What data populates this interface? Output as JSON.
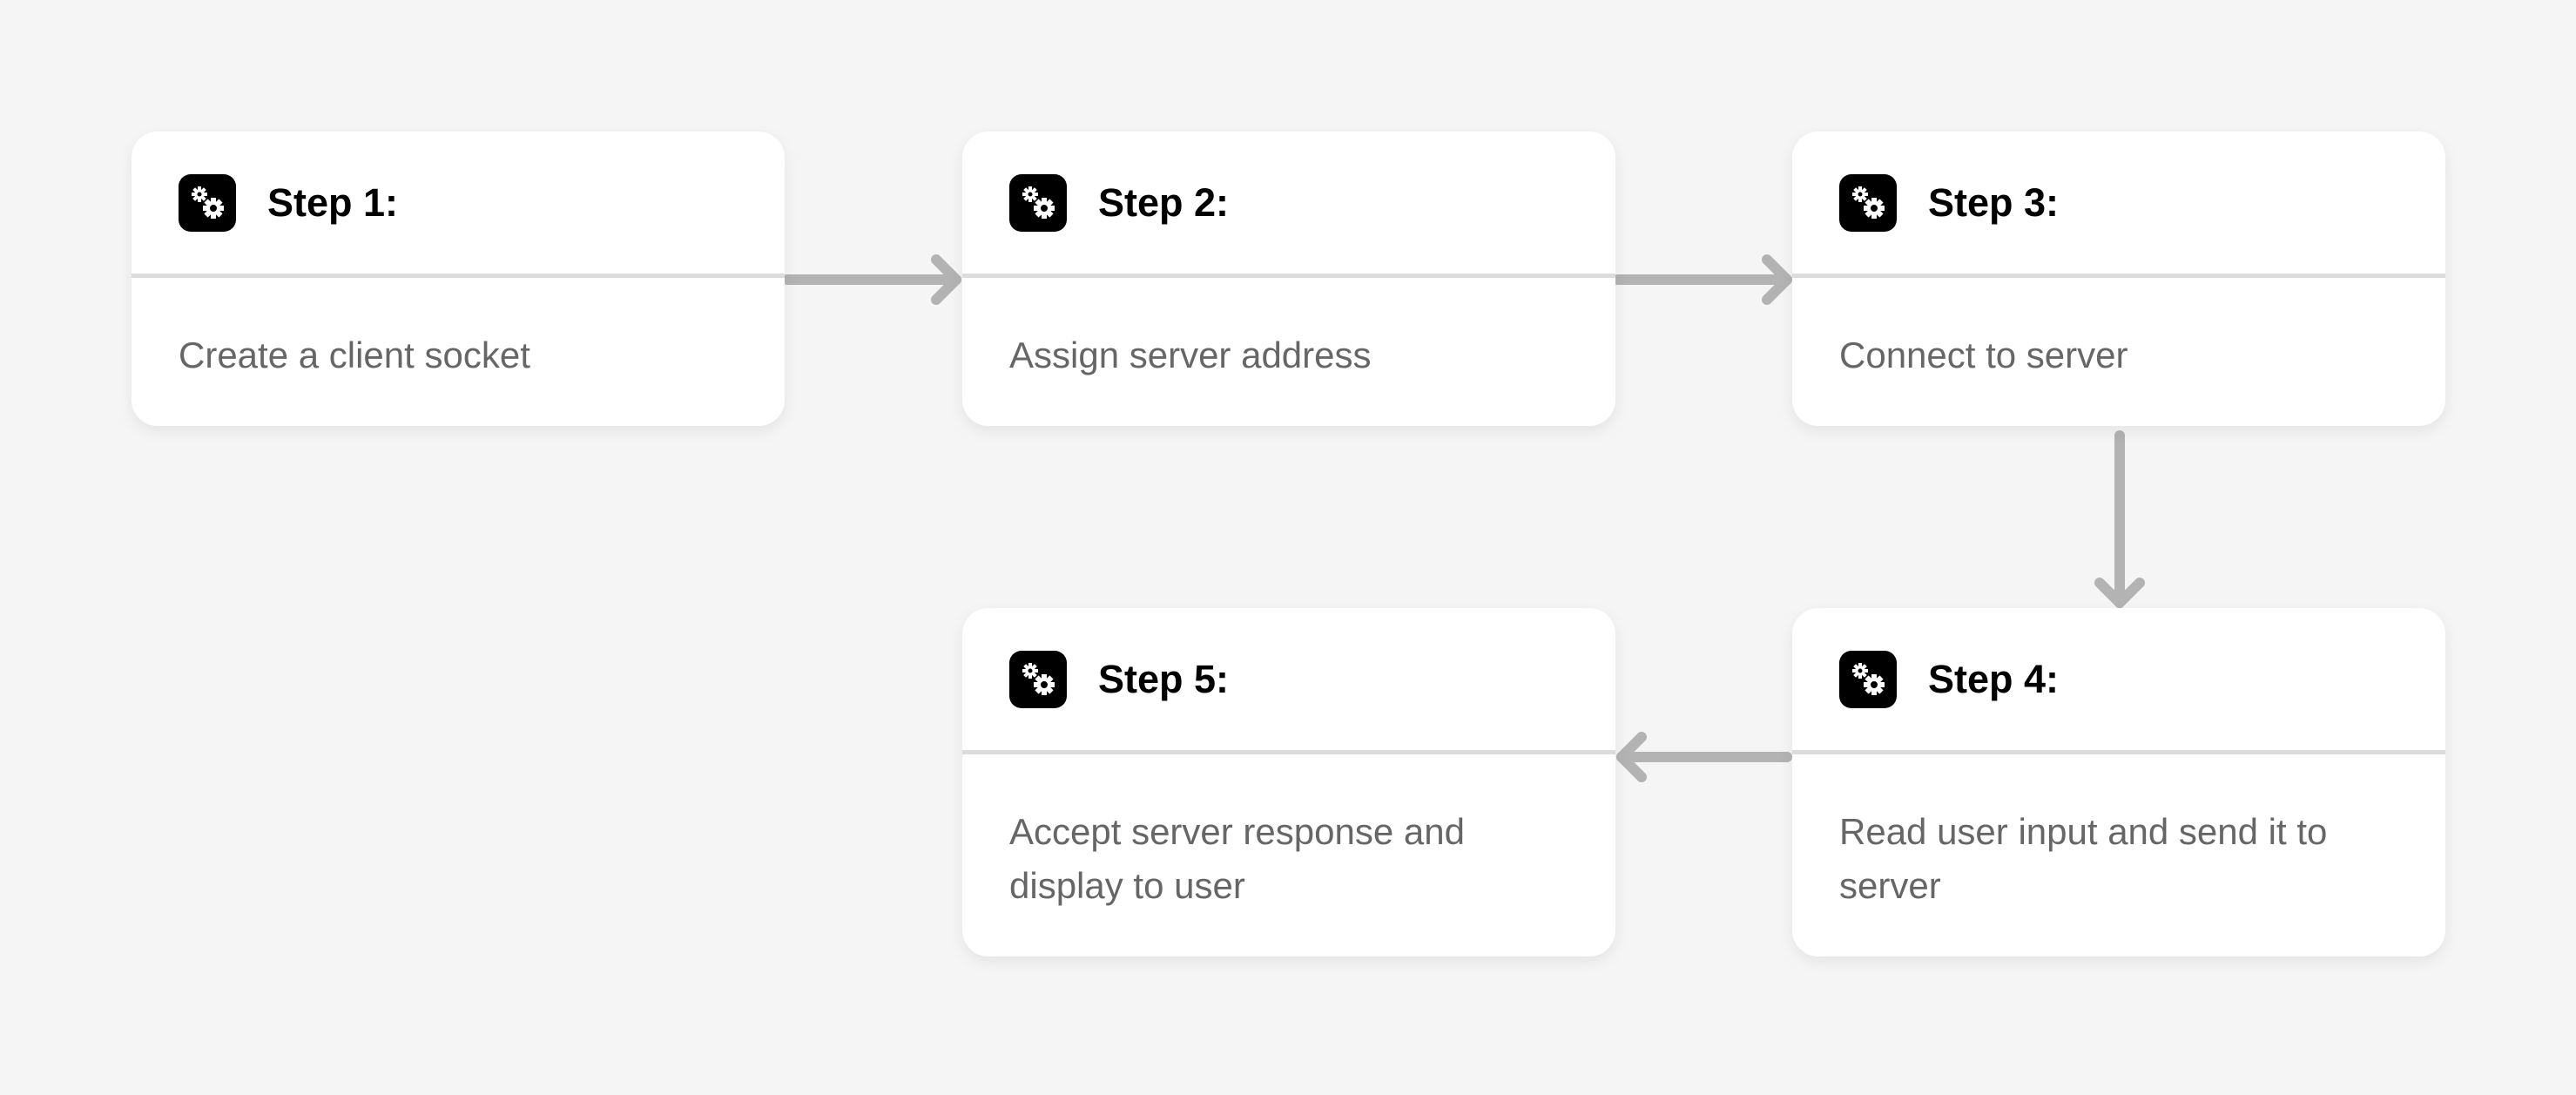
{
  "colors": {
    "background": "#f5f5f5",
    "card": "#ffffff",
    "arrow": "#b3b3b3",
    "divider": "#dcdcdc",
    "icon_bg": "#000000"
  },
  "icon": "gears-icon",
  "steps": [
    {
      "title": "Step 1:",
      "text": "Create a client socket"
    },
    {
      "title": "Step 2:",
      "text": "Assign server address"
    },
    {
      "title": "Step 3:",
      "text": "Connect to server"
    },
    {
      "title": "Step 4:",
      "text": "Read user input and send it to server"
    },
    {
      "title": "Step 5:",
      "text": "Accept server response and display to user"
    }
  ],
  "connections": [
    [
      "Step 1",
      "Step 2"
    ],
    [
      "Step 2",
      "Step 3"
    ],
    [
      "Step 3",
      "Step 4"
    ],
    [
      "Step 4",
      "Step 5"
    ]
  ]
}
